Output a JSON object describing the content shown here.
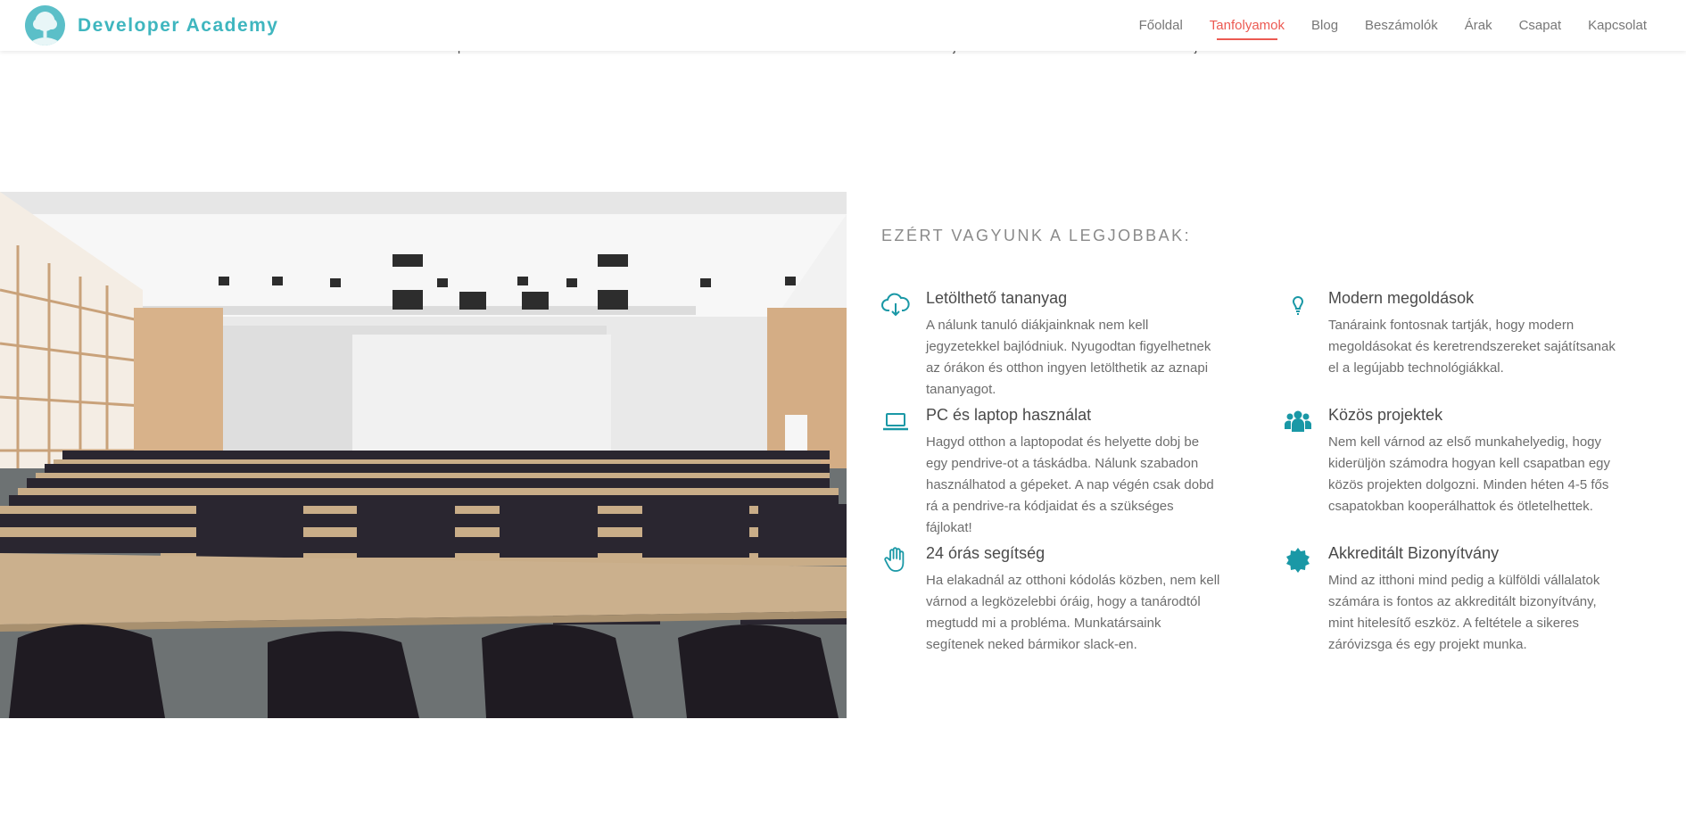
{
  "navbar": {
    "brand": "Developer Academy",
    "links": [
      {
        "label": "Főoldal",
        "active": false
      },
      {
        "label": "Tanfolyamok",
        "active": true
      },
      {
        "label": "Blog",
        "active": false
      },
      {
        "label": "Beszámolók",
        "active": false
      },
      {
        "label": "Árak",
        "active": false
      },
      {
        "label": "Csapat",
        "active": false
      },
      {
        "label": "Kapcsolat",
        "active": false
      }
    ]
  },
  "prev_section": {
    "fragments": [
      "Foursquare.",
      "Vot a JS kódot",
      "fejlesztésel",
      "fejlesztők körében."
    ]
  },
  "features": {
    "title": "EZÉRT VAGYUNK A LEGJOBBAK:",
    "accent_color": "#1a98a6",
    "items": [
      {
        "icon": "cloud-download-icon",
        "title": "Letölthető tananyag",
        "text": "A nálunk tanuló diákjainknak nem kell jegyzetekkel bajlódniuk. Nyugodtan figyelhetnek az órákon és otthon ingyen letölthetik az aznapi tananyagot."
      },
      {
        "icon": "lightbulb-icon",
        "title": "Modern megoldások",
        "text": "Tanáraink fontosnak tartják, hogy modern megoldásokat és keretrendszereket sajátítsanak el a legújabb technológiákkal."
      },
      {
        "icon": "laptop-icon",
        "title": "PC és laptop használat",
        "text": "Hagyd otthon a laptopodat és helyette dobj be egy pendrive-ot a táskádba. Nálunk szabadon használhatod a gépeket. A nap végén csak dobd rá a pendrive-ra kódjaidat és a szükséges fájlokat!"
      },
      {
        "icon": "users-icon",
        "title": "Közös projektek",
        "text": "Nem kell várnod az első munkahelyedig, hogy kiderüljön számodra hogyan kell csapatban egy közös projekten dolgozni. Minden héten 4-5 fős csapatokban kooperálhattok és ötletelhettek."
      },
      {
        "icon": "hand-icon",
        "title": "24 órás segítség",
        "text": "Ha elakadnál az otthoni kódolás közben, nem kell várnod a legközelebbi óráig, hogy a tanárodtól megtudd mi a probléma. Munkatársaink segítenek neked bármikor slack-en."
      },
      {
        "icon": "certificate-icon",
        "title": "Akkreditált Bizonyítvány",
        "text": "Mind az itthoni mind pedig a külföldi vállalatok számára is fontos az akkreditált bizonyítvány, mint hitelesítő eszköz. A feltétele a sikeres záróvizsga és egy projekt munka."
      }
    ]
  }
}
